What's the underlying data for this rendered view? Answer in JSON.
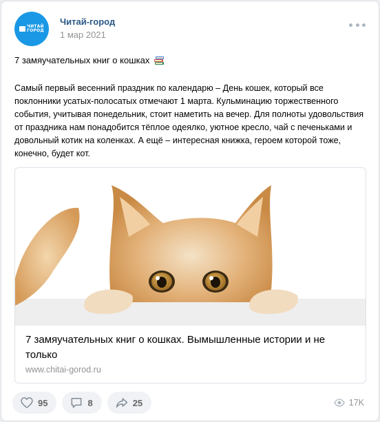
{
  "author": {
    "name": "Читай-город",
    "date": "1 мар 2021",
    "avatar_text": "ЧИТАЙ\nГОРОД"
  },
  "post": {
    "title": "7 замяучательных книг о кошках",
    "title_icon": "books-emoji-icon",
    "body": "Самый первый весенний праздник по календарю – День кошек, который все поклонники усатых-полосатых отмечают 1 марта. Кульминацию торжественного события, учитывая понедельник, стоит наметить на вечер. Для полноты удовольствия от праздника нам понадобится тёплое одеялко, уютное кресло, чай с печеньками и довольный котик на коленках. А ещё – интересная книжка, героем которой тоже, конечно, будет кот."
  },
  "link_card": {
    "title": "7 замяучательных книг о кошках. Вымышленные истории и не только",
    "url": "www.chitai-gorod.ru",
    "image": "ginger-kitten-peeking-over-edge"
  },
  "footer": {
    "likes": "95",
    "comments": "8",
    "shares": "25",
    "views": "17K"
  },
  "colors": {
    "accent": "#2a5885",
    "avatar_bg": "#1a98e6",
    "muted": "#939393",
    "action_bg": "#f0f2f5"
  }
}
